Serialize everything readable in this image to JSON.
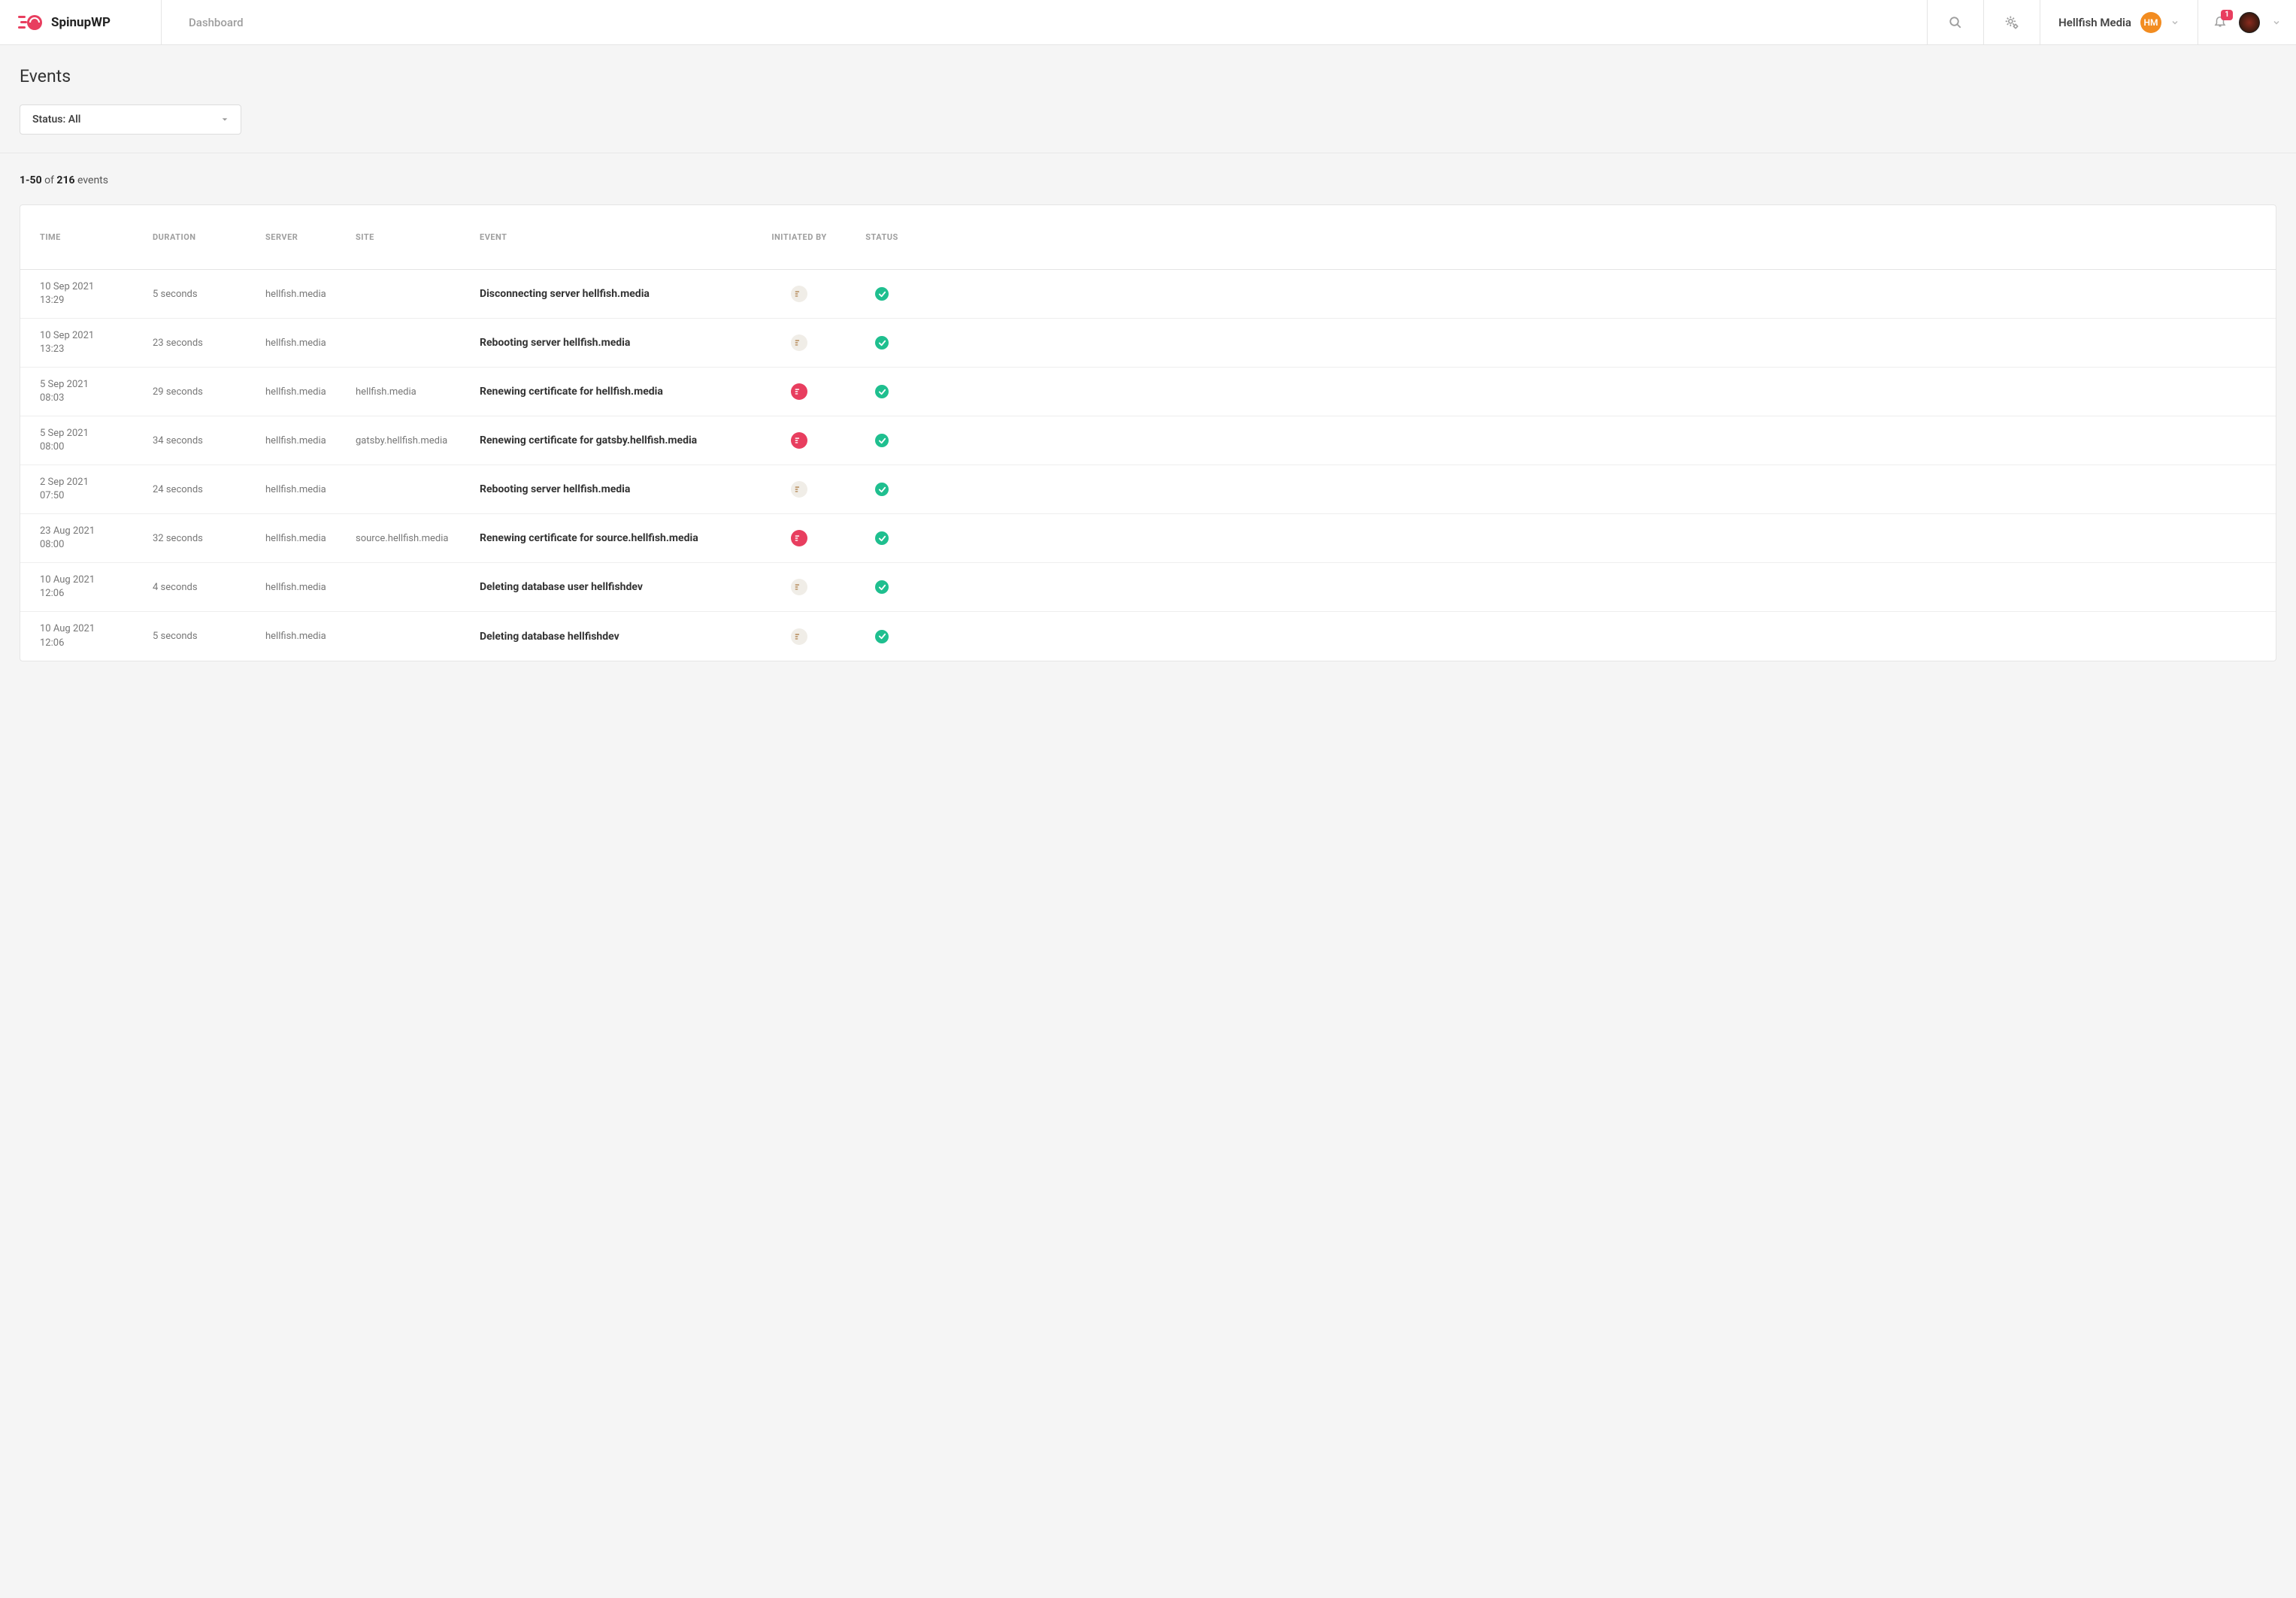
{
  "brand": "SpinupWP",
  "nav": {
    "dashboard": "Dashboard"
  },
  "team": {
    "name": "Hellfish Media",
    "initials": "HM"
  },
  "notifications": {
    "count": "1"
  },
  "page": {
    "title": "Events",
    "filter_label": "Status: All",
    "count_prefix": "1-50",
    "count_middle": " of ",
    "count_total": "216",
    "count_suffix": " events"
  },
  "columns": {
    "time": "TIME",
    "duration": "DURATION",
    "server": "SERVER",
    "site": "SITE",
    "event": "EVENT",
    "initiated_by": "INITIATED BY",
    "status": "STATUS"
  },
  "rows": [
    {
      "date": "10 Sep 2021",
      "clock": "13:29",
      "duration": "5 seconds",
      "server": "hellfish.media",
      "site": "",
      "event": "Disconnecting server hellfish.media",
      "initiator": "user",
      "status": "success"
    },
    {
      "date": "10 Sep 2021",
      "clock": "13:23",
      "duration": "23 seconds",
      "server": "hellfish.media",
      "site": "",
      "event": "Rebooting server hellfish.media",
      "initiator": "user",
      "status": "success"
    },
    {
      "date": "5 Sep 2021",
      "clock": "08:03",
      "duration": "29 seconds",
      "server": "hellfish.media",
      "site": "hellfish.media",
      "event": "Renewing certificate for hellfish.media",
      "initiator": "system",
      "status": "success"
    },
    {
      "date": "5 Sep 2021",
      "clock": "08:00",
      "duration": "34 seconds",
      "server": "hellfish.media",
      "site": "gatsby.hellfish.media",
      "event": "Renewing certificate for gatsby.hellfish.media",
      "initiator": "system",
      "status": "success"
    },
    {
      "date": "2 Sep 2021",
      "clock": "07:50",
      "duration": "24 seconds",
      "server": "hellfish.media",
      "site": "",
      "event": "Rebooting server hellfish.media",
      "initiator": "user",
      "status": "success"
    },
    {
      "date": "23 Aug 2021",
      "clock": "08:00",
      "duration": "32 seconds",
      "server": "hellfish.media",
      "site": "source.hellfish.media",
      "event": "Renewing certificate for source.hellfish.media",
      "initiator": "system",
      "status": "success"
    },
    {
      "date": "10 Aug 2021",
      "clock": "12:06",
      "duration": "4 seconds",
      "server": "hellfish.media",
      "site": "",
      "event": "Deleting database user hellfishdev",
      "initiator": "user",
      "status": "success"
    },
    {
      "date": "10 Aug 2021",
      "clock": "12:06",
      "duration": "5 seconds",
      "server": "hellfish.media",
      "site": "",
      "event": "Deleting database hellfishdev",
      "initiator": "user",
      "status": "success"
    }
  ]
}
